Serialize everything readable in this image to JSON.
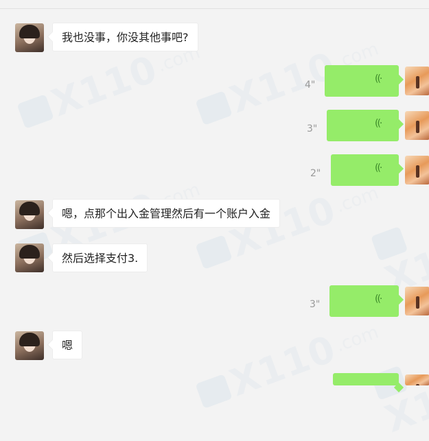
{
  "messages": [
    {
      "side": "left",
      "type": "text",
      "text": "我也没事，你没其他事吧?"
    },
    {
      "side": "right",
      "type": "voice",
      "duration": "4\""
    },
    {
      "side": "right",
      "type": "voice",
      "duration": "3\""
    },
    {
      "side": "right",
      "type": "voice",
      "duration": "2\""
    },
    {
      "side": "left",
      "type": "text",
      "text": "嗯，点那个出入金管理然后有一个账户入金"
    },
    {
      "side": "left",
      "type": "text",
      "text": "然后选择支付3."
    },
    {
      "side": "right",
      "type": "voice",
      "duration": "3\""
    },
    {
      "side": "left",
      "type": "text",
      "text": "嗯"
    }
  ],
  "icons": {
    "voice": "voice-wave-icon"
  },
  "colors": {
    "background": "#f3f3f3",
    "voice_bubble": "#95ec69",
    "text_bubble": "#ffffff"
  }
}
